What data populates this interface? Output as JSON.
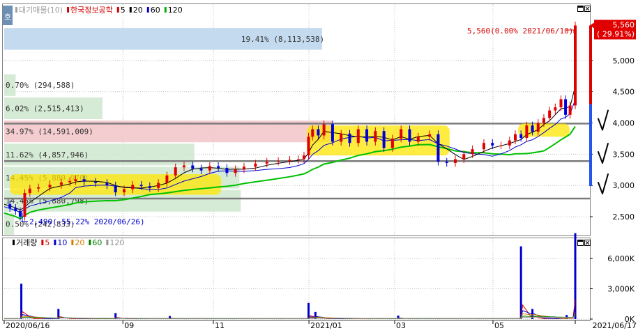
{
  "header": {
    "badge": "호",
    "legend": [
      {
        "label": "대기매물(10)",
        "color": "#a0a0a0"
      },
      {
        "label": "한국정보공학",
        "color": "#d40000"
      },
      {
        "label": "5",
        "color": "#d40000"
      },
      {
        "label": "20",
        "color": "#000000"
      },
      {
        "label": "60",
        "color": "#0000cc"
      },
      {
        "label": "120",
        "color": "#00b000"
      }
    ]
  },
  "volume_header": {
    "legend": [
      {
        "label": "거래량",
        "color": "#000000"
      },
      {
        "label": "5",
        "color": "#d40000"
      },
      {
        "label": "10",
        "color": "#0000cc"
      },
      {
        "label": "20",
        "color": "#d08000"
      },
      {
        "label": "60",
        "color": "#008000"
      },
      {
        "label": "120",
        "color": "#909090"
      }
    ]
  },
  "chart_data": {
    "type": "candlestick",
    "price_axis": {
      "min": 2200,
      "max": 5900,
      "ticks": [
        "2,500",
        "3,000",
        "3,500",
        "4,000",
        "4,500",
        "5,000"
      ],
      "tick_values": [
        2500,
        3000,
        3500,
        4000,
        4500,
        5000
      ]
    },
    "volume_axis": {
      "min": 0,
      "max": 8000,
      "ticks": [
        "0K",
        "3,000K",
        "6,000K"
      ],
      "tick_values": [
        0,
        3000,
        6000
      ]
    },
    "date_axis": {
      "start": "2020/06/16",
      "end": "2021/06/17",
      "labels": [
        {
          "text": "2020/06/16",
          "pos": 0
        },
        {
          "text": "09",
          "pos": 0.2079
        },
        {
          "text": "11",
          "pos": 0.3663
        },
        {
          "text": "2021/01",
          "pos": 0.5337
        },
        {
          "text": "03",
          "pos": 0.6838
        },
        {
          "text": "05",
          "pos": 0.8559
        },
        {
          "text": "2021/06/17",
          "pos": 1
        }
      ]
    },
    "last_price": {
      "value": "5,560",
      "change": "( 29.91%)"
    },
    "annotations": {
      "high": "5,560(0.00% 2021/06/10)",
      "low": "2,490(-55.22% 2020/06/26)"
    },
    "volume_profile": [
      {
        "price_low": 2200,
        "price_high": 2570,
        "label": "0.50% (242,833)",
        "fraction": 0.03
      },
      {
        "price_low": 2570,
        "price_high": 2940,
        "label": "14.45% (5,880,798)",
        "fraction": 0.722
      },
      {
        "price_low": 2940,
        "price_high": 3310,
        "label": "14.45% (5,889,970)",
        "fraction": 0.718
      },
      {
        "price_low": 3310,
        "price_high": 3680,
        "label": "11.62% (4,857,946)",
        "fraction": 0.58
      },
      {
        "price_low": 3680,
        "price_high": 4050,
        "label": "34.97% (14,591,009)",
        "fraction": 1.0
      },
      {
        "price_low": 4050,
        "price_high": 4420,
        "label": "6.02% (2,515,413)",
        "fraction": 0.3
      },
      {
        "price_low": 4420,
        "price_high": 4790,
        "label": "0.70% (294,588)",
        "fraction": 0.035
      },
      {
        "price_low": 5160,
        "price_high": 5530,
        "label": "19.41% (8,113,538)",
        "fraction": 0.97
      }
    ],
    "horizontal_lines": [
      2790,
      3390,
      3990
    ],
    "checkmarks": [
      4000,
      3470,
      2980
    ],
    "price_path": [
      [
        0.0,
        2700
      ],
      [
        0.01,
        2640
      ],
      [
        0.02,
        2590
      ],
      [
        0.028,
        2500
      ],
      [
        0.036,
        2880
      ],
      [
        0.045,
        2950
      ],
      [
        0.06,
        2970
      ],
      [
        0.08,
        3010
      ],
      [
        0.1,
        3050
      ],
      [
        0.115,
        3070
      ],
      [
        0.125,
        3100
      ],
      [
        0.14,
        3060
      ],
      [
        0.16,
        3040
      ],
      [
        0.18,
        3000
      ],
      [
        0.195,
        2890
      ],
      [
        0.21,
        2940
      ],
      [
        0.225,
        3010
      ],
      [
        0.24,
        2990
      ],
      [
        0.255,
        2960
      ],
      [
        0.27,
        3040
      ],
      [
        0.285,
        3160
      ],
      [
        0.3,
        3290
      ],
      [
        0.315,
        3320
      ],
      [
        0.33,
        3270
      ],
      [
        0.345,
        3240
      ],
      [
        0.36,
        3310
      ],
      [
        0.375,
        3280
      ],
      [
        0.39,
        3200
      ],
      [
        0.405,
        3260
      ],
      [
        0.42,
        3300
      ],
      [
        0.44,
        3350
      ],
      [
        0.46,
        3380
      ],
      [
        0.48,
        3390
      ],
      [
        0.5,
        3410
      ],
      [
        0.515,
        3420
      ],
      [
        0.525,
        3480
      ],
      [
        0.533,
        3780
      ],
      [
        0.54,
        3900
      ],
      [
        0.55,
        3800
      ],
      [
        0.56,
        3980
      ],
      [
        0.575,
        3700
      ],
      [
        0.59,
        3830
      ],
      [
        0.605,
        3680
      ],
      [
        0.62,
        3900
      ],
      [
        0.635,
        3700
      ],
      [
        0.65,
        3870
      ],
      [
        0.665,
        3600
      ],
      [
        0.68,
        3750
      ],
      [
        0.695,
        3900
      ],
      [
        0.71,
        3700
      ],
      [
        0.725,
        3780
      ],
      [
        0.745,
        3820
      ],
      [
        0.76,
        3380
      ],
      [
        0.775,
        3360
      ],
      [
        0.79,
        3420
      ],
      [
        0.805,
        3500
      ],
      [
        0.82,
        3580
      ],
      [
        0.84,
        3680
      ],
      [
        0.855,
        3640
      ],
      [
        0.87,
        3640
      ],
      [
        0.885,
        3720
      ],
      [
        0.895,
        3820
      ],
      [
        0.905,
        3760
      ],
      [
        0.915,
        3960
      ],
      [
        0.925,
        3860
      ],
      [
        0.935,
        4000
      ],
      [
        0.945,
        4080
      ],
      [
        0.955,
        4200
      ],
      [
        0.965,
        4250
      ],
      [
        0.975,
        4380
      ],
      [
        0.983,
        4130
      ],
      [
        0.991,
        4280
      ],
      [
        1.0,
        5560
      ]
    ],
    "volume_spikes": [
      {
        "pos": 0.03,
        "value": 3500
      },
      {
        "pos": 0.095,
        "value": 1000
      },
      {
        "pos": 0.195,
        "value": 600
      },
      {
        "pos": 0.29,
        "value": 300
      },
      {
        "pos": 0.533,
        "value": 1600
      },
      {
        "pos": 0.545,
        "value": 700
      },
      {
        "pos": 0.69,
        "value": 350
      },
      {
        "pos": 0.905,
        "value": 7200
      },
      {
        "pos": 0.925,
        "value": 1000
      },
      {
        "pos": 0.985,
        "value": 400
      },
      {
        "pos": 1.0,
        "value": 8500
      }
    ]
  }
}
